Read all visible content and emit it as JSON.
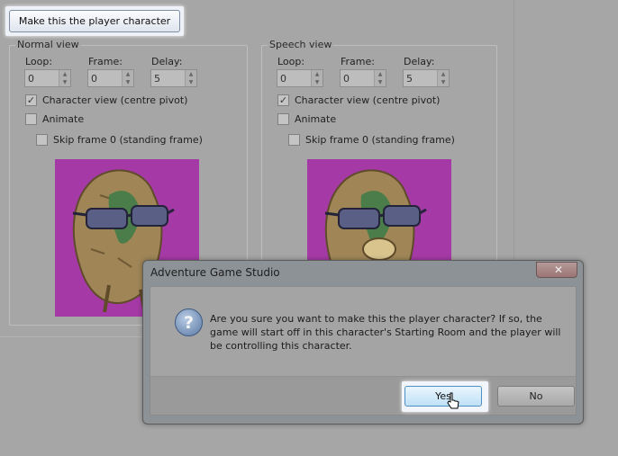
{
  "toolbar": {
    "make_player_label": "Make this the player character"
  },
  "normal_view": {
    "legend": "Normal view",
    "loop_label": "Loop:",
    "loop_value": "0",
    "frame_label": "Frame:",
    "frame_value": "0",
    "delay_label": "Delay:",
    "delay_value": "5",
    "character_view_label": "Character view (centre pivot)",
    "character_view_checked": true,
    "animate_label": "Animate",
    "animate_checked": false,
    "skip_frame_label": "Skip frame 0 (standing frame)",
    "skip_frame_checked": false
  },
  "speech_view": {
    "legend": "Speech view",
    "loop_label": "Loop:",
    "loop_value": "0",
    "frame_label": "Frame:",
    "frame_value": "0",
    "delay_label": "Delay:",
    "delay_value": "5",
    "character_view_label": "Character view (centre pivot)",
    "character_view_checked": true,
    "animate_label": "Animate",
    "animate_checked": false,
    "skip_frame_label": "Skip frame 0 (standing frame)",
    "skip_frame_checked": false
  },
  "dialog": {
    "title": "Adventure Game Studio",
    "close_glyph": "✕",
    "icon_glyph": "?",
    "message": "Are you sure you want to make this the player character? If so, the game will start off in this character's Starting Room and the player will be controlling this character.",
    "yes_label": "Yes",
    "no_label": "No"
  },
  "colors": {
    "sprite_background": "#a53aa6",
    "focus_button_border": "#4f8fc4"
  }
}
